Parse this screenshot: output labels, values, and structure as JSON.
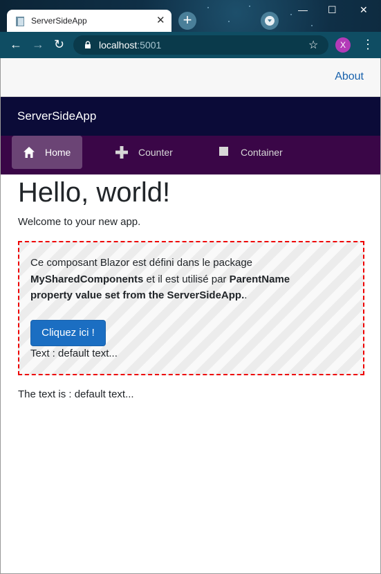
{
  "browser": {
    "tab_title": "ServerSideApp",
    "tab_close": "✕",
    "new_tab": "+",
    "url_host": "localhost",
    "url_port": ":5001",
    "profile_initial": "X",
    "window_minimize": "—",
    "window_maximize": "☐",
    "window_close": "✕"
  },
  "header": {
    "about_link": "About",
    "brand": "ServerSideApp"
  },
  "nav": {
    "items": [
      {
        "label": "Home",
        "icon": "home-icon",
        "active": true
      },
      {
        "label": "Counter",
        "icon": "plus-icon",
        "active": false
      },
      {
        "label": "Container",
        "icon": "square-icon",
        "active": false
      }
    ]
  },
  "main": {
    "heading": "Hello, world!",
    "welcome": "Welcome to your new app.",
    "component": {
      "text_1": "Ce composant Blazor est défini dans le package",
      "package_name": "MySharedComponents",
      "text_2": " et il est utilisé par ",
      "parent_name": "ParentName property value set from the ServerSideApp.",
      "text_3": ".",
      "button_label": "Cliquez ici !",
      "text_line": "Text : default text..."
    },
    "result_text": "The text is : default text..."
  },
  "colors": {
    "accent": "#1b6ec2",
    "brand_bg": "#0b0b38",
    "nav_bg": "#3a0647",
    "dashed_border": "#ee0000"
  }
}
